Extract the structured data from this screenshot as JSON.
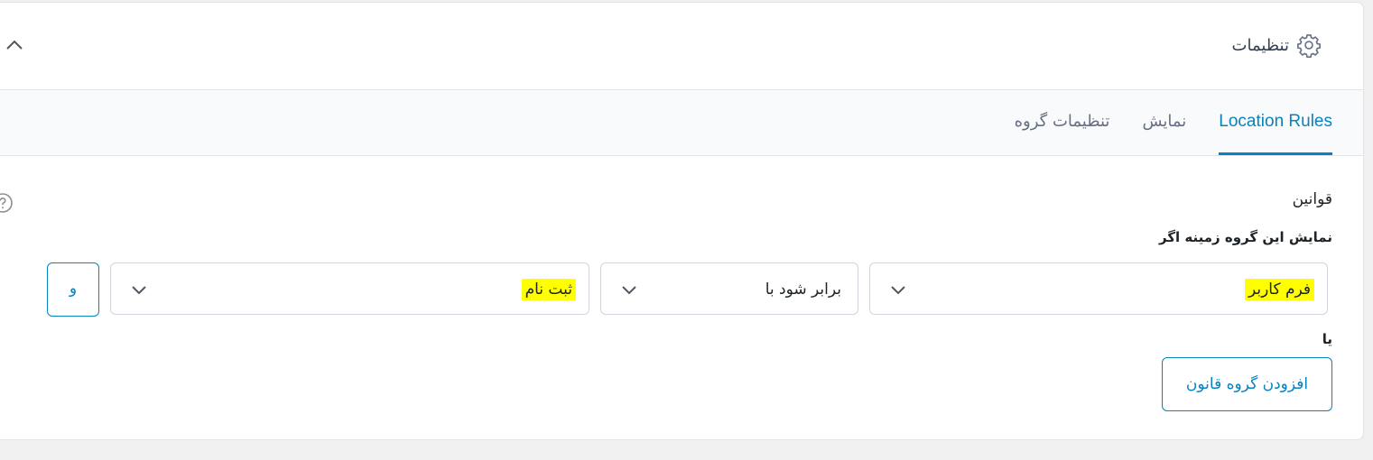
{
  "header": {
    "title": "تنظیمات",
    "settings_icon": "gear-icon",
    "collapse_icon": "chevron-up-icon"
  },
  "tabs": [
    {
      "label": "Location Rules",
      "active": true
    },
    {
      "label": "نمایش",
      "active": false
    },
    {
      "label": "تنظیمات گروه",
      "active": false
    }
  ],
  "rules": {
    "section_label": "قوانین",
    "show_if_label": "نمایش این گروه زمینه اگر",
    "help_icon": "help-circle-icon",
    "param_select": "فرم کاربر",
    "operator_select": "برابر شود با",
    "value_select": "ثبت نام",
    "and_button": "و",
    "or_label": "یا",
    "add_group_button": "افزودن گروه قانون"
  },
  "colors": {
    "accent": "#0783be",
    "highlight": "#ffff00",
    "border": "#d0d5dd"
  }
}
